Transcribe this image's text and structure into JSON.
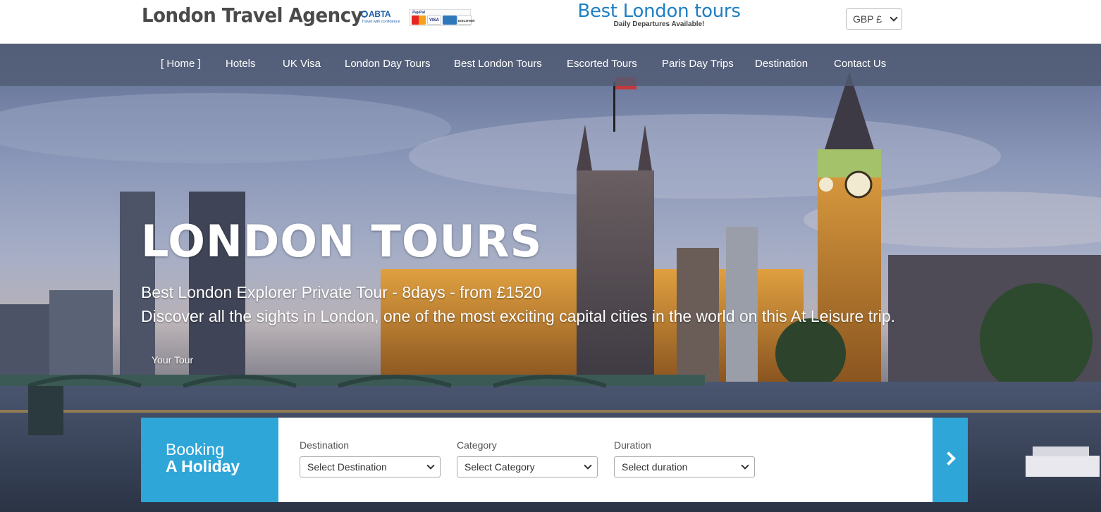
{
  "header": {
    "brand": "London Travel Agency",
    "abta_logo": {
      "name": "ABTA",
      "tagline": "Travel with confidence"
    },
    "payment_logos": {
      "paypal": "PayPal",
      "cards": [
        "MasterCard",
        "VISA",
        "AMEX",
        "DISCOVER"
      ]
    },
    "promo_title": "Best London tours",
    "promo_subtitle": "Daily Departures Available!",
    "currency": "GBP £"
  },
  "nav": {
    "items": [
      {
        "label": "Home",
        "active": true
      },
      {
        "label": "Hotels"
      },
      {
        "label": "UK Visa"
      },
      {
        "label": "London Day Tours"
      },
      {
        "label": "Best London Tours"
      },
      {
        "label": "Escorted Tours"
      },
      {
        "label": "Paris Day Trips"
      },
      {
        "label": "Destination"
      },
      {
        "label": "Contact Us"
      }
    ],
    "active_left_bracket": "[",
    "active_right_bracket": "]"
  },
  "hero": {
    "title": "LONDON TOURS",
    "subtitle": "Best London Explorer Private Tour - 8days - from £1520",
    "description": "Discover all the sights in London, one of the most exciting capital cities in the world on this At Leisure trip.",
    "cta": "Your Tour"
  },
  "booking": {
    "label_line1": "Booking",
    "label_line2": "A Holiday",
    "fields": [
      {
        "label": "Destination",
        "value": "Select Destination"
      },
      {
        "label": "Category",
        "value": "Select Category"
      },
      {
        "label": "Duration",
        "value": "Select duration"
      }
    ],
    "submit_icon": "chevron-right-icon"
  },
  "colors": {
    "accent": "#2fa6d8",
    "promo_blue": "#1e7fc4",
    "nav_bg": "#505c74"
  }
}
